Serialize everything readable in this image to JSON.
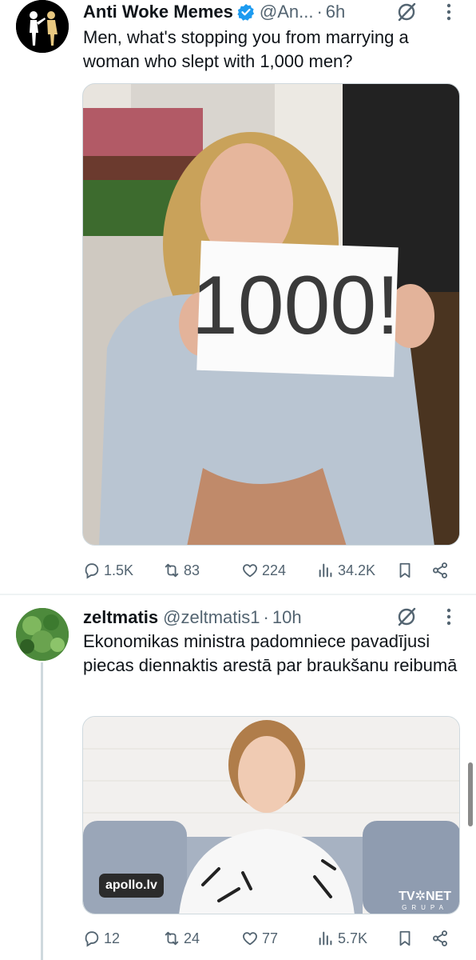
{
  "tweet1": {
    "display_name": "Anti Woke Memes",
    "handle": "@An...",
    "separator": "·",
    "time": "6h",
    "text": "Men, what's stopping you from marrying a woman who slept with 1,000 men?",
    "sign_text": "1000!",
    "stats": {
      "replies": "1.5K",
      "reposts": "83",
      "likes": "224",
      "views": "34.2K"
    }
  },
  "tweet2": {
    "display_name": "zeltmatis",
    "handle": "@zeltmatis1",
    "separator": "·",
    "time": "10h",
    "text": "Ekonomikas ministra padomniece pavadījusi piecas diennaktis arestā par braukšanu reibumā",
    "media_badge": "apollo.lv",
    "media_logo": "TV✲NET",
    "media_logo_sub": "GRUPA",
    "stats": {
      "replies": "12",
      "reposts": "24",
      "likes": "77",
      "views": "5.7K"
    }
  },
  "colors": {
    "text": "#0f1419",
    "secondary": "#536471",
    "verified": "#1d9bf0",
    "divider": "#eff3f4"
  },
  "icons": [
    "reply-icon",
    "repost-icon",
    "like-icon",
    "views-icon",
    "bookmark-icon",
    "share-icon",
    "grok-icon",
    "more-icon",
    "verified-icon"
  ]
}
